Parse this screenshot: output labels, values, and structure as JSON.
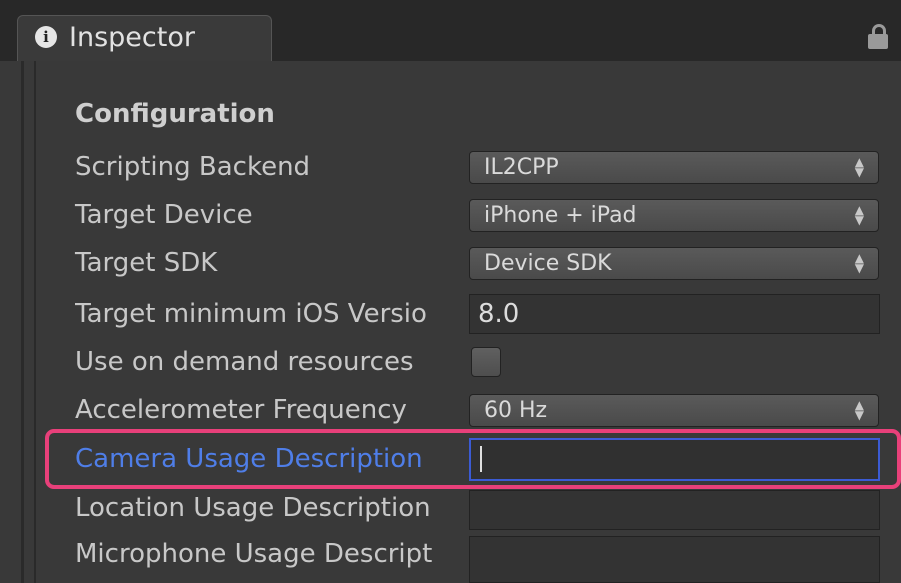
{
  "tab": {
    "title": "Inspector",
    "icon": "info-icon",
    "lock_icon": "lock-icon"
  },
  "section": {
    "title": "Configuration"
  },
  "rows": {
    "scripting_backend": {
      "label": "Scripting Backend",
      "value": "IL2CPP"
    },
    "target_device": {
      "label": "Target Device",
      "value": "iPhone + iPad"
    },
    "target_sdk": {
      "label": "Target SDK",
      "value": "Device SDK"
    },
    "min_ios": {
      "label": "Target minimum iOS Versio",
      "value": "8.0"
    },
    "on_demand": {
      "label": "Use on demand resources",
      "checked": false
    },
    "accelerometer": {
      "label": "Accelerometer Frequency",
      "value": "60 Hz"
    },
    "camera_usage": {
      "label": "Camera Usage Description",
      "value": ""
    },
    "location_usage": {
      "label": "Location Usage Description",
      "value": ""
    },
    "microphone_usage": {
      "label": "Microphone Usage Descript",
      "value": ""
    }
  },
  "colors": {
    "panel_bg": "#393939",
    "focus_blue": "#3b5bd4",
    "active_label": "#4f7ee8",
    "highlight_pink": "#e8407a"
  }
}
